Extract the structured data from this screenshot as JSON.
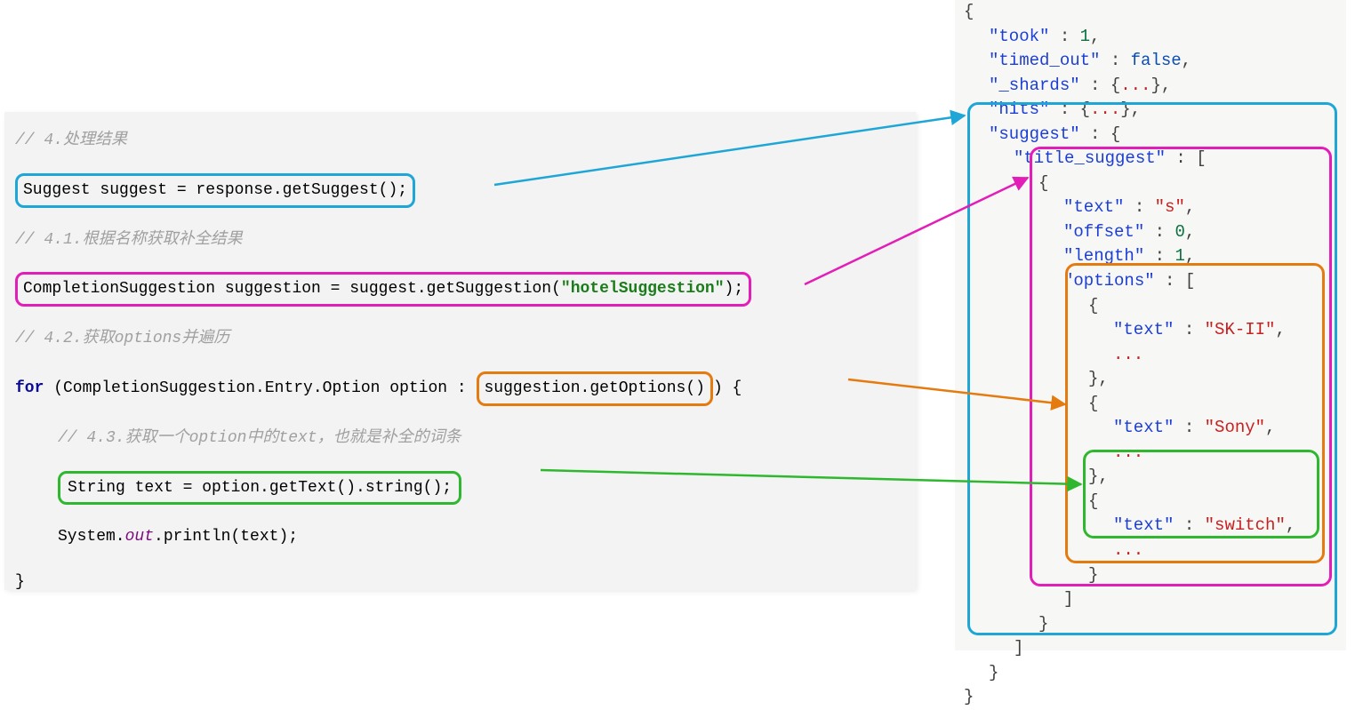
{
  "left": {
    "comment_4": "// 4.处理结果",
    "line_suggest": "Suggest suggest = response.getSuggest();",
    "comment_41": "// 4.1.根据名称获取补全结果",
    "line_completion_pre": "CompletionSuggestion suggestion = suggest.getSuggestion(",
    "hotel_suggestion": "\"hotelSuggestion\"",
    "line_completion_post": ");",
    "comment_42": "// 4.2.获取options并遍历",
    "for_kw": "for",
    "for_pre": " (CompletionSuggestion.Entry.Option option : ",
    "get_options": "suggestion.getOptions()",
    "for_post": ") {",
    "comment_43": "// 4.3.获取一个option中的text，也就是补全的词条",
    "line_text": "String text = option.getText().string();",
    "println_pre": "System.",
    "println_out": "out",
    "println_post": ".println(text);",
    "close_brace": "}"
  },
  "right": {
    "open": "{",
    "took_k": "\"took\"",
    "took_v": "1",
    "timed_k": "\"timed_out\"",
    "timed_v": "false",
    "shards_k": "\"_shards\"",
    "ellipsis": "...",
    "hits_k": "\"hits\"",
    "suggest_k": "\"suggest\"",
    "title_k": "\"title_suggest\"",
    "text_k": "\"text\"",
    "text_s": "\"s\"",
    "offset_k": "\"offset\"",
    "offset_v": "0",
    "length_k": "\"length\"",
    "length_v": "1",
    "options_k": "\"options\"",
    "skii": "\"SK-II\"",
    "sony": "\"Sony\"",
    "switch": "\"switch\"",
    "arr_close": "]",
    "obj_close": "}",
    "colon": " : ",
    "comma": ",",
    "obj_open": " : {",
    "arr_open": " : ["
  },
  "colors": {
    "cyan": "#1ea6d6",
    "magenta": "#e31db8",
    "orange": "#e57a0f",
    "green": "#2fb82f"
  }
}
